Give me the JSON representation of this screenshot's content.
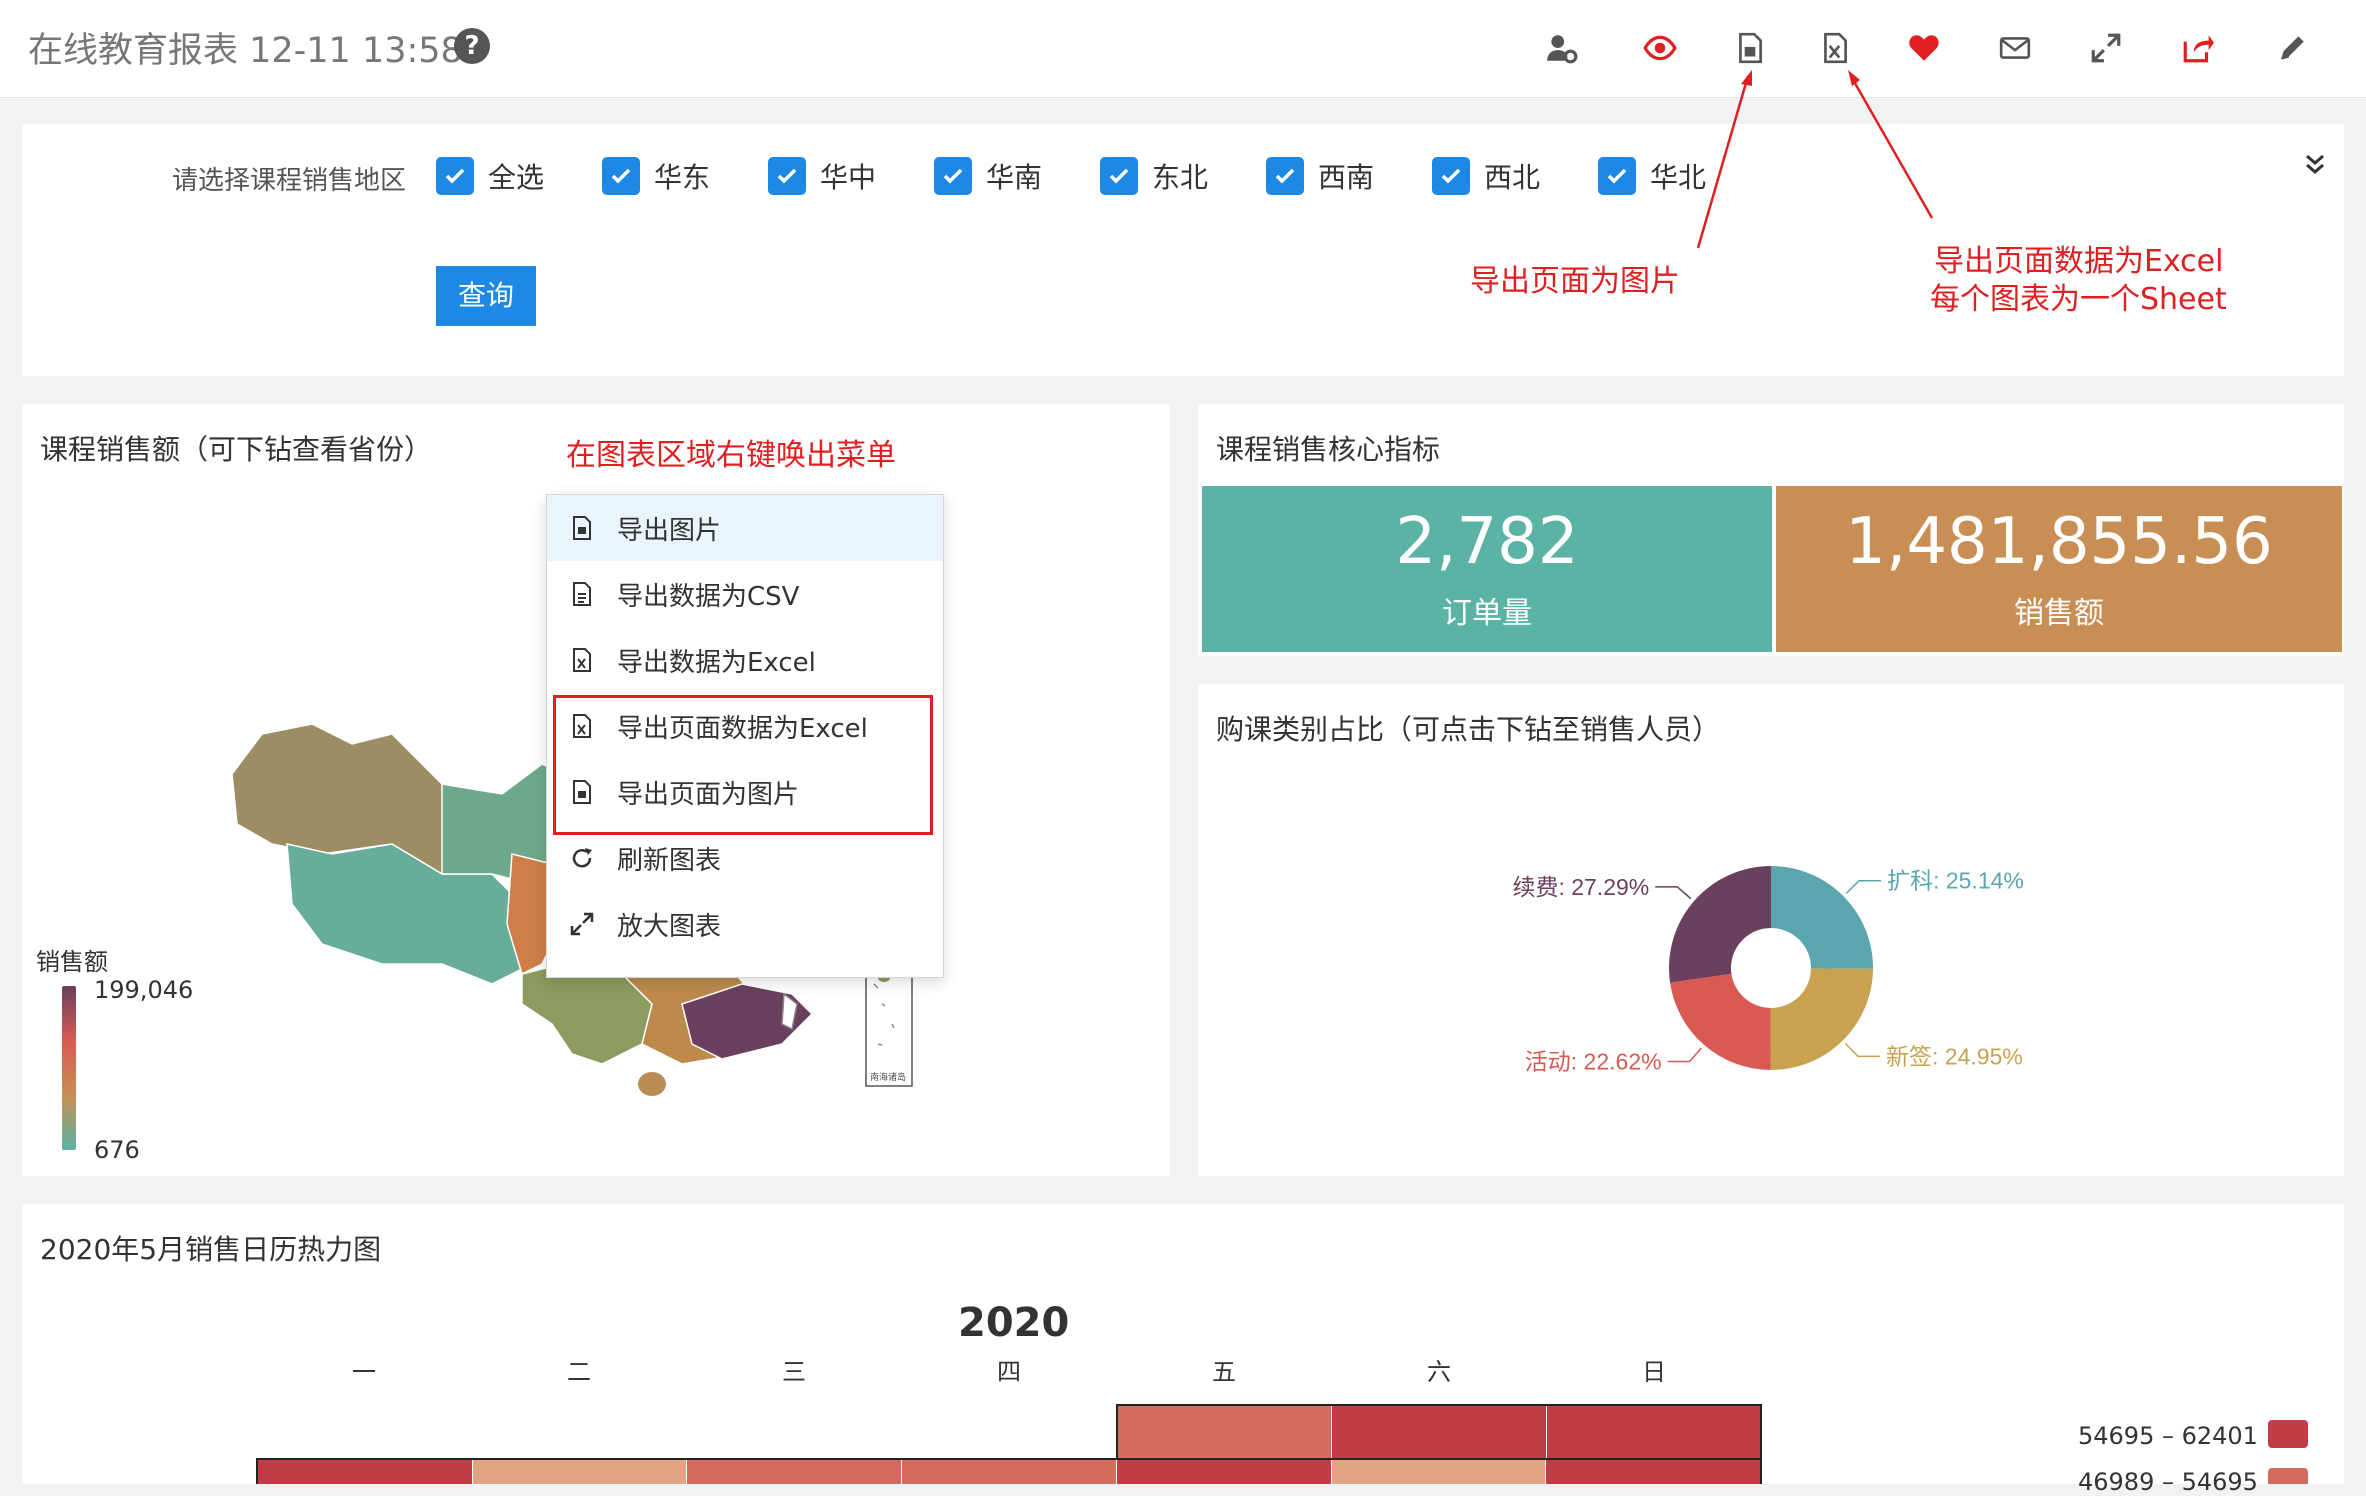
{
  "header": {
    "title": "在线教育报表 12-11 13:58",
    "help_icon": "question-circle-icon",
    "toolbar_icons": [
      "user-settings-icon",
      "eye-icon",
      "export-image-icon",
      "export-excel-icon",
      "heart-icon",
      "mail-icon",
      "expand-icon",
      "share-icon",
      "edit-icon"
    ]
  },
  "filter": {
    "label": "请选择课程销售地区",
    "options": [
      "全选",
      "华东",
      "华中",
      "华南",
      "东北",
      "西南",
      "西北",
      "华北"
    ],
    "query_button": "查询"
  },
  "annotations": {
    "export_image": "导出页面为图片",
    "export_excel_line1": "导出页面数据为Excel",
    "export_excel_line2": "每个图表为一个Sheet",
    "right_click": "在图表区域右键唤出菜单"
  },
  "map_panel": {
    "title": "课程销售额（可下钻查看省份）",
    "legend_title": "销售额",
    "legend_max": "199,046",
    "legend_min": "676",
    "south_sea_label": "南海诸岛"
  },
  "context_menu": {
    "items": [
      "导出图片",
      "导出数据为CSV",
      "导出数据为Excel",
      "导出页面数据为Excel",
      "导出页面为图片",
      "刷新图表",
      "放大图表"
    ]
  },
  "kpi_panel": {
    "title": "课程销售核心指标",
    "orders_value": "2,782",
    "orders_label": "订单量",
    "sales_value": "1,481,855.56",
    "sales_label": "销售额",
    "colors": {
      "orders": "#5bb3a6",
      "sales": "#c98e54"
    }
  },
  "donut_panel": {
    "title": "购课类别占比（可点击下钻至销售人员）"
  },
  "chart_data": [
    {
      "type": "pie",
      "categories": [
        "扩科",
        "新签",
        "活动",
        "续费"
      ],
      "values": [
        25.14,
        24.95,
        22.62,
        27.29
      ],
      "labels": [
        "扩科: 25.14%",
        "新签: 24.95%",
        "活动: 22.62%",
        "续费: 27.29%"
      ],
      "colors": [
        "#5aa5ae",
        "#c9a24f",
        "#d85a52",
        "#6b3f5e"
      ]
    }
  ],
  "heatmap_panel": {
    "title": "2020年5月销售日历热力图",
    "year": "2020",
    "weekdays": [
      "一",
      "二",
      "三",
      "四",
      "五",
      "六",
      "日"
    ],
    "legend": [
      {
        "label": "54695 – 62401",
        "color": "#c23c48"
      },
      {
        "label": "46989 – 54695",
        "color": "#d66a5e"
      }
    ]
  }
}
